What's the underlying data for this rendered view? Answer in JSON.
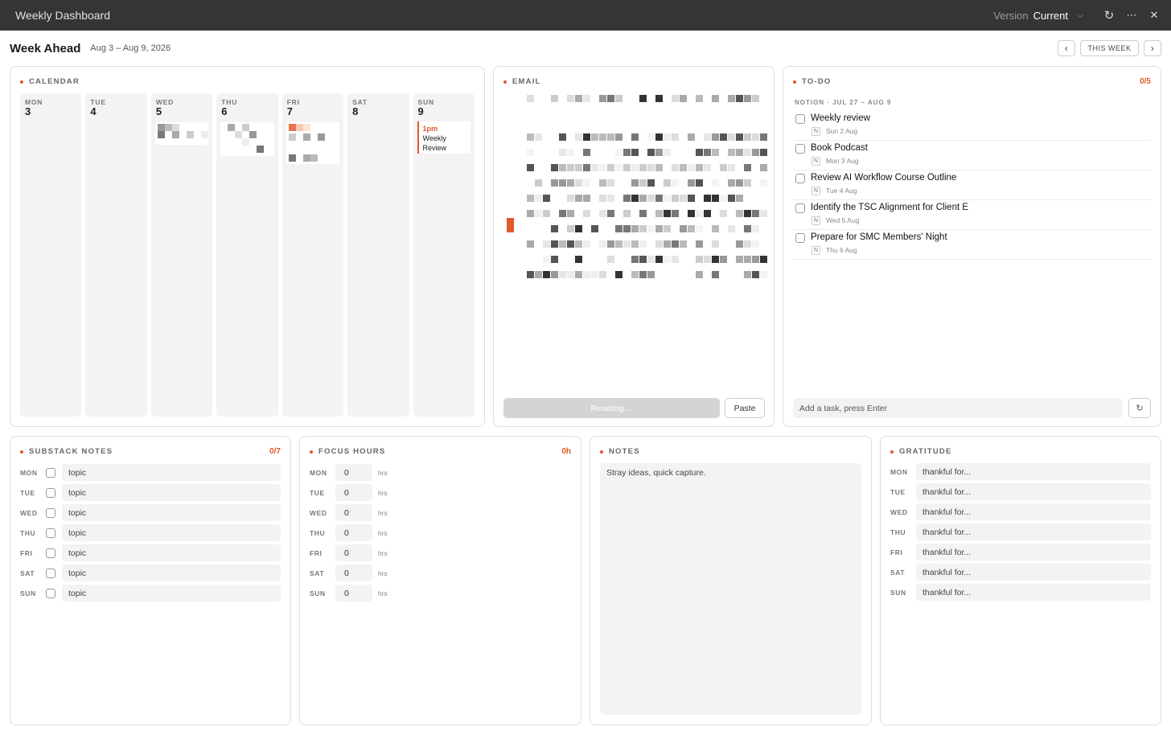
{
  "window": {
    "title": "Weekly Dashboard",
    "version_label": "Version",
    "version_value": "Current"
  },
  "header": {
    "title": "Week Ahead",
    "range": "Aug 3 – Aug 9, 2026",
    "this_week": "THIS WEEK",
    "prev": "‹",
    "next": "›"
  },
  "calendar": {
    "title": "CALENDAR",
    "days": [
      {
        "name": "MON",
        "num": "3"
      },
      {
        "name": "TUE",
        "num": "4"
      },
      {
        "name": "WED",
        "num": "5"
      },
      {
        "name": "THU",
        "num": "6"
      },
      {
        "name": "FRI",
        "num": "7"
      },
      {
        "name": "SAT",
        "num": "8"
      },
      {
        "name": "SUN",
        "num": "9"
      }
    ],
    "event": {
      "time": "1pm",
      "title": "Weekly Review"
    }
  },
  "email": {
    "title": "EMAIL",
    "reading": "Reading…",
    "paste": "Paste"
  },
  "todo": {
    "title": "TO-DO",
    "count": "0/5",
    "source": "NOTION · JUL 27 – AUG 9",
    "badge": "N",
    "items": [
      {
        "label": "Weekly review",
        "date": "Sun 2 Aug"
      },
      {
        "label": "Book Podcast",
        "date": "Mon 3 Aug"
      },
      {
        "label": "Review AI Workflow Course Outline",
        "date": "Tue 4 Aug"
      },
      {
        "label": "Identify the TSC Alignment for Client E",
        "date": "Wed 5 Aug"
      },
      {
        "label": "Prepare for SMC Members' Night",
        "date": "Thu 6 Aug"
      }
    ],
    "add_placeholder": "Add a task, press Enter"
  },
  "substack": {
    "title": "SUBSTACK NOTES",
    "count": "0/7",
    "rows": [
      {
        "day": "MON",
        "value": "topic"
      },
      {
        "day": "TUE",
        "value": "topic"
      },
      {
        "day": "WED",
        "value": "topic"
      },
      {
        "day": "THU",
        "value": "topic"
      },
      {
        "day": "FRI",
        "value": "topic"
      },
      {
        "day": "SAT",
        "value": "topic"
      },
      {
        "day": "SUN",
        "value": "topic"
      }
    ]
  },
  "focus": {
    "title": "FOCUS HOURS",
    "total": "0h",
    "unit": "hrs",
    "rows": [
      {
        "day": "MON",
        "value": "0"
      },
      {
        "day": "TUE",
        "value": "0"
      },
      {
        "day": "WED",
        "value": "0"
      },
      {
        "day": "THU",
        "value": "0"
      },
      {
        "day": "FRI",
        "value": "0"
      },
      {
        "day": "SAT",
        "value": "0"
      },
      {
        "day": "SUN",
        "value": "0"
      }
    ]
  },
  "notes": {
    "title": "NOTES",
    "placeholder": "Stray ideas, quick capture."
  },
  "gratitude": {
    "title": "GRATITUDE",
    "rows": [
      {
        "day": "MON",
        "value": "thankful for..."
      },
      {
        "day": "TUE",
        "value": "thankful for..."
      },
      {
        "day": "WED",
        "value": "thankful for..."
      },
      {
        "day": "THU",
        "value": "thankful for..."
      },
      {
        "day": "FRI",
        "value": "thankful for..."
      },
      {
        "day": "SAT",
        "value": "thankful for..."
      },
      {
        "day": "SUN",
        "value": "thankful for..."
      }
    ]
  },
  "colors": {
    "accent": "#e05a2b",
    "titlebar": "#353535"
  }
}
